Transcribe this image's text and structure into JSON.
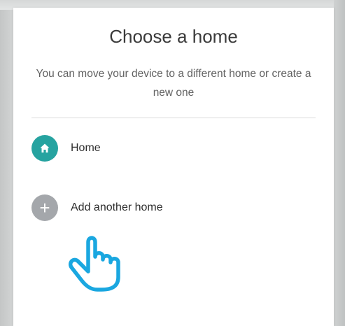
{
  "dialog": {
    "title": "Choose a home",
    "subtitle": "You can move your device to a different home or create a new one",
    "items": [
      {
        "label": "Home",
        "icon": "home-icon",
        "color": "#26a3a0"
      },
      {
        "label": "Add another home",
        "icon": "plus-icon",
        "glyph": "+",
        "color": "#a4a7ab"
      }
    ]
  },
  "overlay": {
    "icon": "pointing-hand-icon",
    "color": "#1aa7e0"
  }
}
